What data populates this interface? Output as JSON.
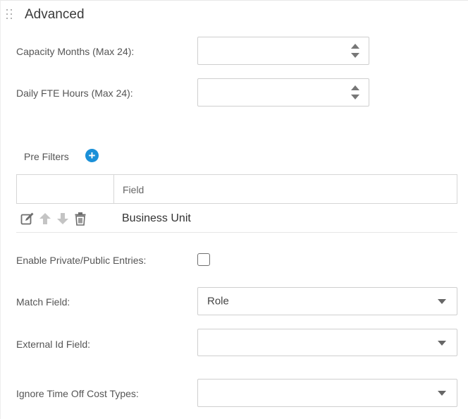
{
  "section": {
    "title": "Advanced"
  },
  "fields": {
    "capacity_months": {
      "label": "Capacity Months (Max 24):",
      "value": ""
    },
    "daily_fte_hours": {
      "label": "Daily FTE Hours (Max 24):",
      "value": ""
    }
  },
  "prefilters": {
    "label": "Pre Filters",
    "add_icon": "plus-circle-icon",
    "accent_color": "#1a90d8",
    "columns": [
      "",
      "Field"
    ],
    "rows": [
      {
        "actions": [
          "edit-icon",
          "arrow-up-icon",
          "arrow-down-icon",
          "trash-icon"
        ],
        "field": "Business Unit"
      }
    ]
  },
  "enable_private_public": {
    "label": "Enable Private/Public Entries:",
    "checked": false
  },
  "match_field": {
    "label": "Match Field:",
    "value": "Role"
  },
  "external_id_field": {
    "label": "External Id Field:",
    "value": ""
  },
  "ignore_time_off": {
    "label": "Ignore Time Off Cost Types:",
    "value": ""
  }
}
